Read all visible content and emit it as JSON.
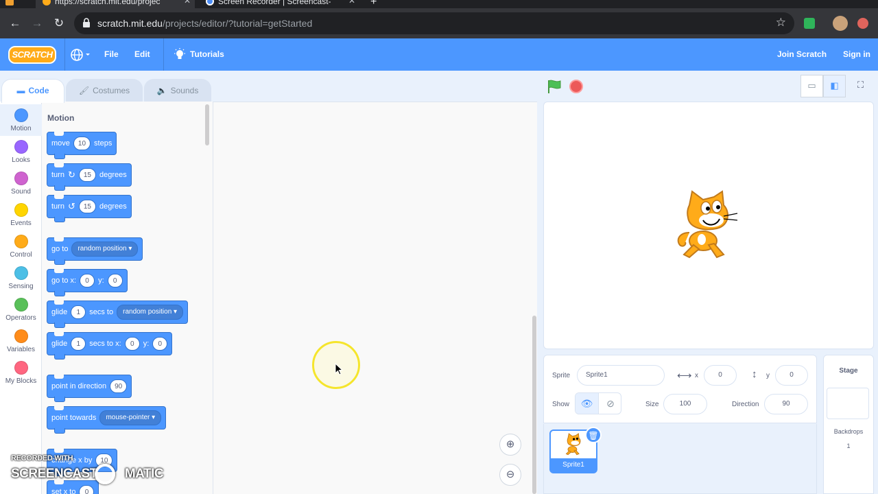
{
  "browser": {
    "tabs": [
      {
        "title": "https://scratch.mit.edu/projec"
      },
      {
        "title": "Screen Recorder | Screencast-"
      }
    ],
    "url_domain": "scratch.mit.edu",
    "url_path": "/projects/editor/?tutorial=getStarted"
  },
  "menubar": {
    "logo": "SCRATCH",
    "file": "File",
    "edit": "Edit",
    "tutorials": "Tutorials",
    "join": "Join Scratch",
    "signin": "Sign in"
  },
  "editor_tabs": {
    "code": "Code",
    "costumes": "Costumes",
    "sounds": "Sounds"
  },
  "categories": [
    {
      "label": "Motion",
      "color": "#4c97ff"
    },
    {
      "label": "Looks",
      "color": "#9966ff"
    },
    {
      "label": "Sound",
      "color": "#cf63cf"
    },
    {
      "label": "Events",
      "color": "#ffd500"
    },
    {
      "label": "Control",
      "color": "#ffab19"
    },
    {
      "label": "Sensing",
      "color": "#4cbfe6"
    },
    {
      "label": "Operators",
      "color": "#59c059"
    },
    {
      "label": "Variables",
      "color": "#ff8c1a"
    },
    {
      "label": "My Blocks",
      "color": "#ff6680"
    }
  ],
  "palette": {
    "title": "Motion",
    "move": {
      "pre": "move",
      "value": "10",
      "post": "steps"
    },
    "turn_right": {
      "pre": "turn",
      "value": "15",
      "post": "degrees"
    },
    "turn_left": {
      "pre": "turn",
      "value": "15",
      "post": "degrees"
    },
    "goto": {
      "pre": "go to",
      "option": "random position"
    },
    "goto_xy": {
      "pre": "go to x:",
      "x": "0",
      "mid": "y:",
      "y": "0"
    },
    "glide_to": {
      "pre": "glide",
      "value": "1",
      "mid": "secs to",
      "option": "random position"
    },
    "glide_xy": {
      "pre": "glide",
      "value": "1",
      "mid": "secs to x:",
      "x": "0",
      "ylabel": "y:",
      "y": "0"
    },
    "point_dir": {
      "pre": "point in direction",
      "value": "90"
    },
    "point_towards": {
      "pre": "point towards",
      "option": "mouse-pointer"
    },
    "change_x": {
      "pre": "change x by",
      "value": "10"
    },
    "set_x": {
      "pre": "set x to",
      "value": "0"
    }
  },
  "sprite_info": {
    "sprite_label": "Sprite",
    "sprite_name": "Sprite1",
    "x_label": "x",
    "x_value": "0",
    "y_label": "y",
    "y_value": "0",
    "show_label": "Show",
    "size_label": "Size",
    "size_value": "100",
    "direction_label": "Direction",
    "direction_value": "90"
  },
  "sprites": [
    {
      "name": "Sprite1"
    }
  ],
  "stage_panel": {
    "title": "Stage",
    "backdrops_label": "Backdrops",
    "backdrops_count": "1"
  },
  "watermark": {
    "top": "RECORDED WITH",
    "main_left": "SCREENCAST",
    "main_right": "MATIC"
  },
  "colors": {
    "scratch_blue": "#4c97ff",
    "menubar": "#4c97ff",
    "cursor_highlight": "#f5e52c"
  }
}
